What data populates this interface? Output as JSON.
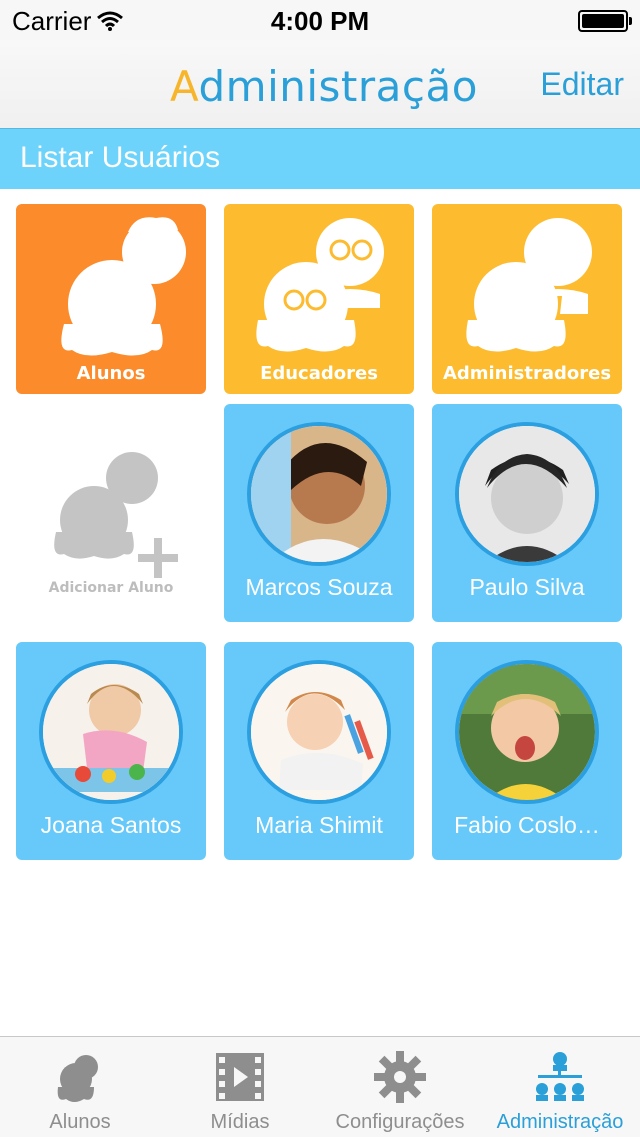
{
  "status_bar": {
    "carrier": "Carrier",
    "time": "4:00 PM"
  },
  "nav": {
    "title_first": "A",
    "title_rest": "dministração",
    "edit_label": "Editar"
  },
  "section": {
    "title": "Listar Usuários"
  },
  "categories": [
    {
      "label": "Alunos",
      "color": "#fb8b2b"
    },
    {
      "label": "Educadores",
      "color": "#fdbb2f"
    },
    {
      "label": "Administradores",
      "color": "#fdbb2f"
    }
  ],
  "add_student": {
    "label": "Adicionar Aluno"
  },
  "students": [
    {
      "name": "Marcos Souza"
    },
    {
      "name": "Paulo Silva"
    },
    {
      "name": "Joana Santos"
    },
    {
      "name": "Maria Shimit"
    },
    {
      "name": "Fabio Coslo…"
    }
  ],
  "tabs": [
    {
      "label": "Alunos",
      "icon": "students-icon"
    },
    {
      "label": "Mídias",
      "icon": "film-icon"
    },
    {
      "label": "Configurações",
      "icon": "gear-icon"
    },
    {
      "label": "Administração",
      "icon": "admin-icon",
      "active": true
    }
  ],
  "colors": {
    "accent": "#2a9fd8",
    "section_bg": "#6dd3fb",
    "student_tile": "#66c9fa",
    "orange": "#fb8b2b",
    "yellow": "#fdbb2f"
  }
}
